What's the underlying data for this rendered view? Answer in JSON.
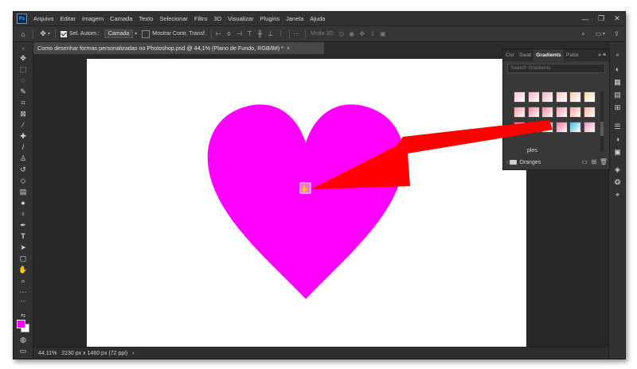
{
  "app": {
    "logo": "Ps"
  },
  "menu": [
    "Arquivo",
    "Editar",
    "Imagem",
    "Camada",
    "Texto",
    "Selecionar",
    "Filtro",
    "3D",
    "Visualizar",
    "Plugins",
    "Janela",
    "Ajuda"
  ],
  "window_controls": [
    "—",
    "❐",
    "✕"
  ],
  "options": {
    "auto_select_label": "Sel. Autom.:",
    "auto_select_value": "Camada",
    "transform_label": "Mostrar Contr. Transf.",
    "mode_label": "Modo 3D:"
  },
  "tools": [
    "move-tool-icon",
    "marquee-tool-icon",
    "lasso-tool-icon",
    "quick-select-tool-icon",
    "crop-tool-icon",
    "frame-tool-icon",
    "eyedropper-tool-icon",
    "healing-brush-icon",
    "brush-tool-icon",
    "clone-stamp-icon",
    "history-brush-icon",
    "eraser-tool-icon",
    "gradient-tool-icon",
    "blur-tool-icon",
    "dodge-tool-icon",
    "pen-tool-icon",
    "type-tool-icon",
    "path-select-icon",
    "shape-tool-icon",
    "hand-tool-icon",
    "zoom-tool-icon",
    "more-tools-icon"
  ],
  "colors": {
    "foreground": "#ff00ff",
    "background": "#ffffff",
    "heart": "#ff00ff",
    "arrow": "#ff0000",
    "accent": "#31a8ff"
  },
  "document": {
    "tab_title": "Como desenhar formas personalizadas no Photoshop.psd @ 44,1% (Plano de Fundo, RGB/8#) *",
    "close": "×"
  },
  "status": {
    "zoom": "44,11%",
    "info": "2230 px x 1460 px (72 ppi)",
    "chevron": "›"
  },
  "panel": {
    "tabs": [
      "Cor",
      "Swat",
      "Gradients",
      "Patte"
    ],
    "active_tab": "Gradients",
    "menu_glyph": "»  ≡",
    "search_placeholder": "Search Gradients",
    "partial_folder": "ples",
    "folder": "Oranges",
    "footer_icons": [
      "folder-icon",
      "new-icon",
      "trash-icon"
    ],
    "gradients": [
      [
        "#f7c6cf",
        "#f3b2c1",
        "#f6b0b8",
        "#f7c8c8",
        "#f9c9b3",
        "#f5d9b0"
      ],
      [
        "#f59aa7",
        "#f285a0",
        "#f4859a",
        "#f69aa5",
        "#f9a59a",
        "#f7b59c"
      ],
      [
        "#ef6d8c",
        "#f080b0",
        "#f59ab5",
        "#f56da0",
        "#4ab7df",
        "#f090b5"
      ]
    ]
  }
}
